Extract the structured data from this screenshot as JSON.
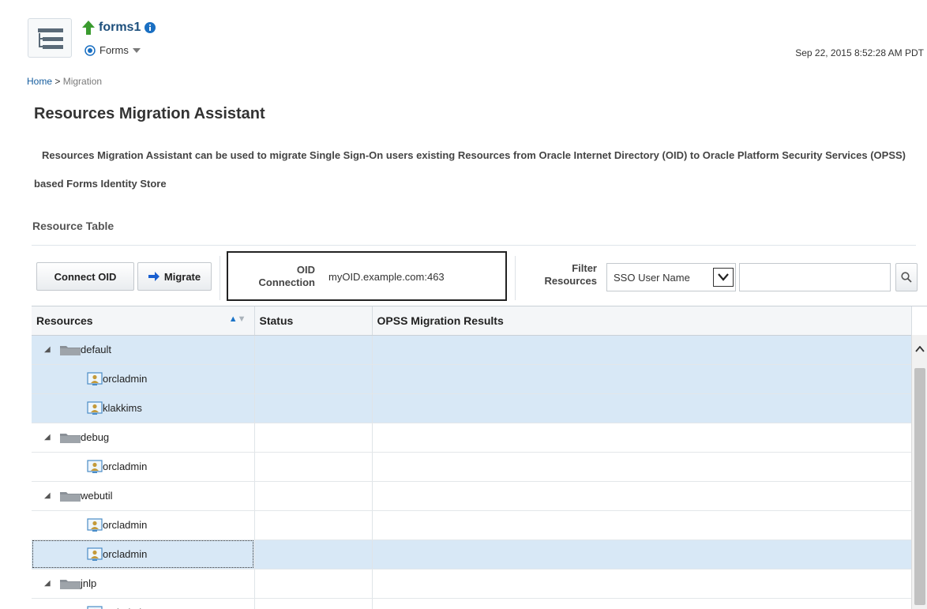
{
  "target": {
    "name": "forms1",
    "menu_label": "Forms"
  },
  "timestamp": "Sep 22, 2015 8:52:28 AM PDT",
  "breadcrumb": {
    "home": "Home",
    "separator": ">",
    "current": "Migration"
  },
  "page": {
    "title": "Resources Migration Assistant",
    "description": "Resources Migration Assistant can be used to migrate Single Sign-On users existing Resources from Oracle Internet Directory (OID) to Oracle Platform Security Services (OPSS) based Forms Identity Store"
  },
  "section_title": "Resource Table",
  "toolbar": {
    "connect_label": "Connect OID",
    "migrate_label": "Migrate",
    "oid_label_1": "OID",
    "oid_label_2": "Connection",
    "oid_value": "myOID.example.com:463",
    "filter_label_1": "Filter",
    "filter_label_2": "Resources",
    "filter_selected": "SSO User Name",
    "filter_value": ""
  },
  "table": {
    "columns": [
      "Resources",
      "Status",
      "OPSS Migration Results"
    ],
    "rows": [
      {
        "label": "default",
        "type": "folder",
        "level": 0,
        "status": "",
        "result": "",
        "selected": true
      },
      {
        "label": "orcladmin",
        "type": "user",
        "level": 1,
        "status": "",
        "result": "",
        "selected": true
      },
      {
        "label": "klakkims",
        "type": "user",
        "level": 1,
        "status": "",
        "result": "",
        "selected": true
      },
      {
        "label": "debug",
        "type": "folder",
        "level": 0,
        "status": "",
        "result": "",
        "selected": false
      },
      {
        "label": "orcladmin",
        "type": "user",
        "level": 1,
        "status": "",
        "result": "",
        "selected": false
      },
      {
        "label": "webutil",
        "type": "folder",
        "level": 0,
        "status": "",
        "result": "",
        "selected": false
      },
      {
        "label": "orcladmin",
        "type": "user",
        "level": 1,
        "status": "",
        "result": "",
        "selected": false
      },
      {
        "label": "orcladmin",
        "type": "user",
        "level": 1,
        "status": "",
        "result": "",
        "selected": true,
        "focused": true
      },
      {
        "label": "jnlp",
        "type": "folder",
        "level": 0,
        "status": "",
        "result": "",
        "selected": false
      },
      {
        "label": "orcladmin",
        "type": "user",
        "level": 1,
        "status": "",
        "result": "",
        "selected": false
      }
    ]
  },
  "colors": {
    "title_blue": "#1d4f7c",
    "link_blue": "#145c9e",
    "selection": "#d8e8f6",
    "up_arrow_green": "#3a9b2f"
  },
  "icons": [
    "target-navigation-icon",
    "status-up-arrow-icon",
    "info-icon",
    "target-radio-icon",
    "dropdown-arrow-icon",
    "migrate-arrow-icon",
    "search-icon",
    "folder-icon",
    "user-icon",
    "sort-ascending-icon",
    "sort-descending-icon",
    "collapse-triangle-icon",
    "scroll-up-icon"
  ]
}
